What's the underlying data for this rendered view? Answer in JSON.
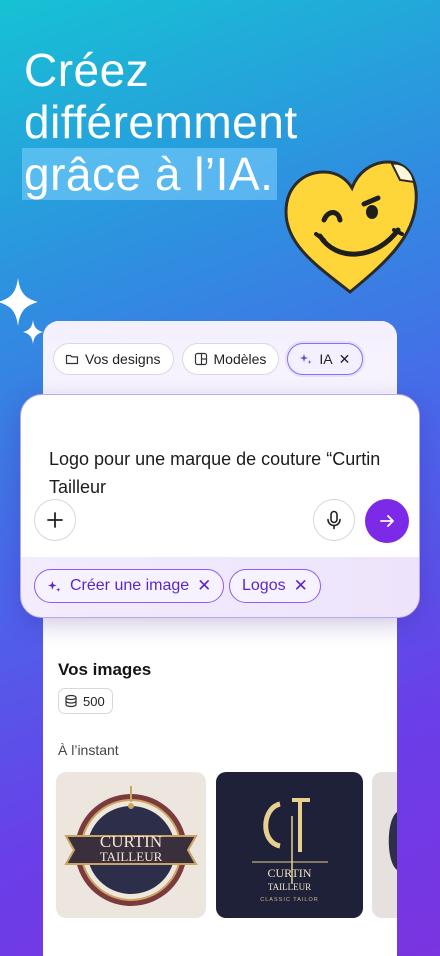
{
  "headline": {
    "line1": "Créez",
    "line2": "différemment",
    "line3": "grâce à l’IA."
  },
  "chips": {
    "designs": "Vos designs",
    "templates": "Modèles",
    "ai": "IA",
    "ai_close": "✕"
  },
  "prompt": {
    "text": "Logo pour une marque de couture “Curtin Tailleur",
    "add_label": "+",
    "mic_icon": "microphone-icon",
    "send_icon": "arrow-right-icon"
  },
  "suggestions": [
    {
      "label": "Créer une image",
      "close": "✕"
    },
    {
      "label": "Logos",
      "close": "✕"
    }
  ],
  "images_section": {
    "title": "Vos images",
    "credits": "500",
    "subtitle": "À l’instant"
  },
  "thumbnails": [
    {
      "line1": "CURTIN",
      "line2": "TAILLEUR"
    },
    {
      "line1": "CURTIN",
      "line2": "TAILLEUR",
      "tagline": "CLASSIC TAILOR"
    }
  ],
  "colors": {
    "accent": "#7d2ae8",
    "chip_border": "#8d5cf0"
  }
}
